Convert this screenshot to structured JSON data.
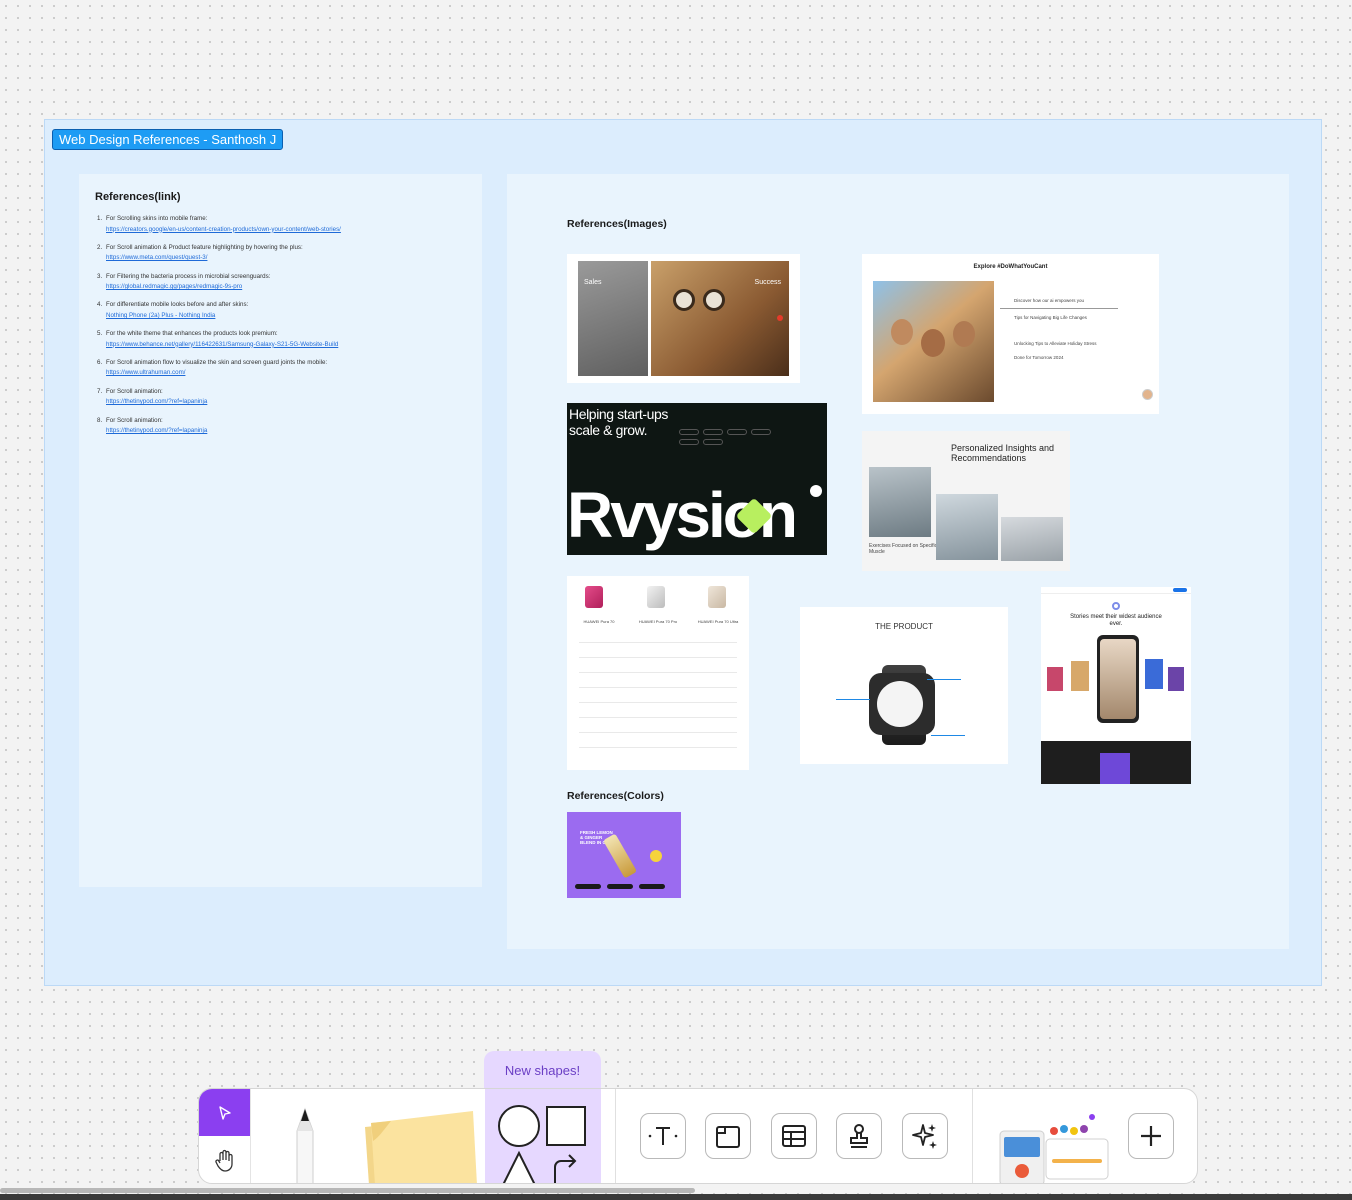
{
  "section": {
    "title": "Web Design References - Santhosh J"
  },
  "links_panel": {
    "heading": "References(link)",
    "items": [
      {
        "num": "1.",
        "text": "For Scrolling skins into mobile frame:",
        "link": "https://creators.google/en-us/content-creation-products/own-your-content/web-stories/"
      },
      {
        "num": "2.",
        "text": "For Scroll animation & Product feature highlighting by hovering the plus:",
        "link": "https://www.meta.com/quest/quest-3/"
      },
      {
        "num": "3.",
        "text": "For Filtering the bacteria process in microbial screenguards:",
        "link": "https://global.redmagic.gg/pages/redmagic-9s-pro"
      },
      {
        "num": "4.",
        "text": "For differentiate mobile looks before and after skins:",
        "link": "Nothing Phone (2a) Plus - Nothing India"
      },
      {
        "num": "5.",
        "text": "For the white theme that enhances the products look premium:",
        "link": "https://www.behance.net/gallery/116422631/Samsung-Galaxy-S21-5G-Website-Build"
      },
      {
        "num": "6.",
        "text": "For Scroll animation flow to visualize the skin and screen guard joints the mobile:",
        "link": "https://www.ultrahuman.com/"
      },
      {
        "num": "7.",
        "text": "For Scroll animation:",
        "link": "https://thetinypod.com/?ref=lapaninja"
      },
      {
        "num": "8.",
        "text": "For Scroll animation:",
        "link": "https://thetinypod.com/?ref=lapaninja"
      }
    ]
  },
  "images_panel": {
    "heading_images": "References(Images)",
    "heading_colors": "References(Colors)",
    "card_sales": {
      "left": "Sales",
      "right": "Success"
    },
    "card_explore": {
      "title": "Explore #DoWhatYouCant",
      "items": [
        "Discover how our ai empowers you",
        "Tips for Navigating Big Life Changes",
        "Unlocking Tips to Alleviate Holiday Stress",
        "Done for Tomorrow 2024"
      ]
    },
    "card_rvysion": {
      "tagline": "Helping start-ups scale & grow.",
      "brand": "Rvysion"
    },
    "card_insights": {
      "title": "Personalized Insights and Recommendations",
      "caption": "Exercises Focused on Specific Muscle"
    },
    "card_huawei": {
      "models": [
        "HUAWEI Pura 70",
        "HUAWEI Pura 70 Pro",
        "HUAWEI Pura 70 Ultra"
      ]
    },
    "card_product": {
      "title": "THE PRODUCT"
    },
    "card_stories": {
      "title": "Stories meet their widest audience ever."
    },
    "card_colors": {
      "title": "FRESH LEMON & GINGER BLEND IN ONE"
    }
  },
  "toolbar": {
    "badge": "New shapes!",
    "tools": [
      "select-tool",
      "hand-tool",
      "pencil-tool",
      "sticky-note-tool",
      "shapes-tool",
      "text-tool",
      "section-tool",
      "table-tool",
      "stamp-tool",
      "ai-sparkle-tool",
      "widgets-tool",
      "more-tool"
    ]
  },
  "colors": {
    "accent": "#8b3ff0",
    "section_bg": "#dcedfd",
    "section_title": "#1e9cf4",
    "link": "#1e6ad8"
  }
}
